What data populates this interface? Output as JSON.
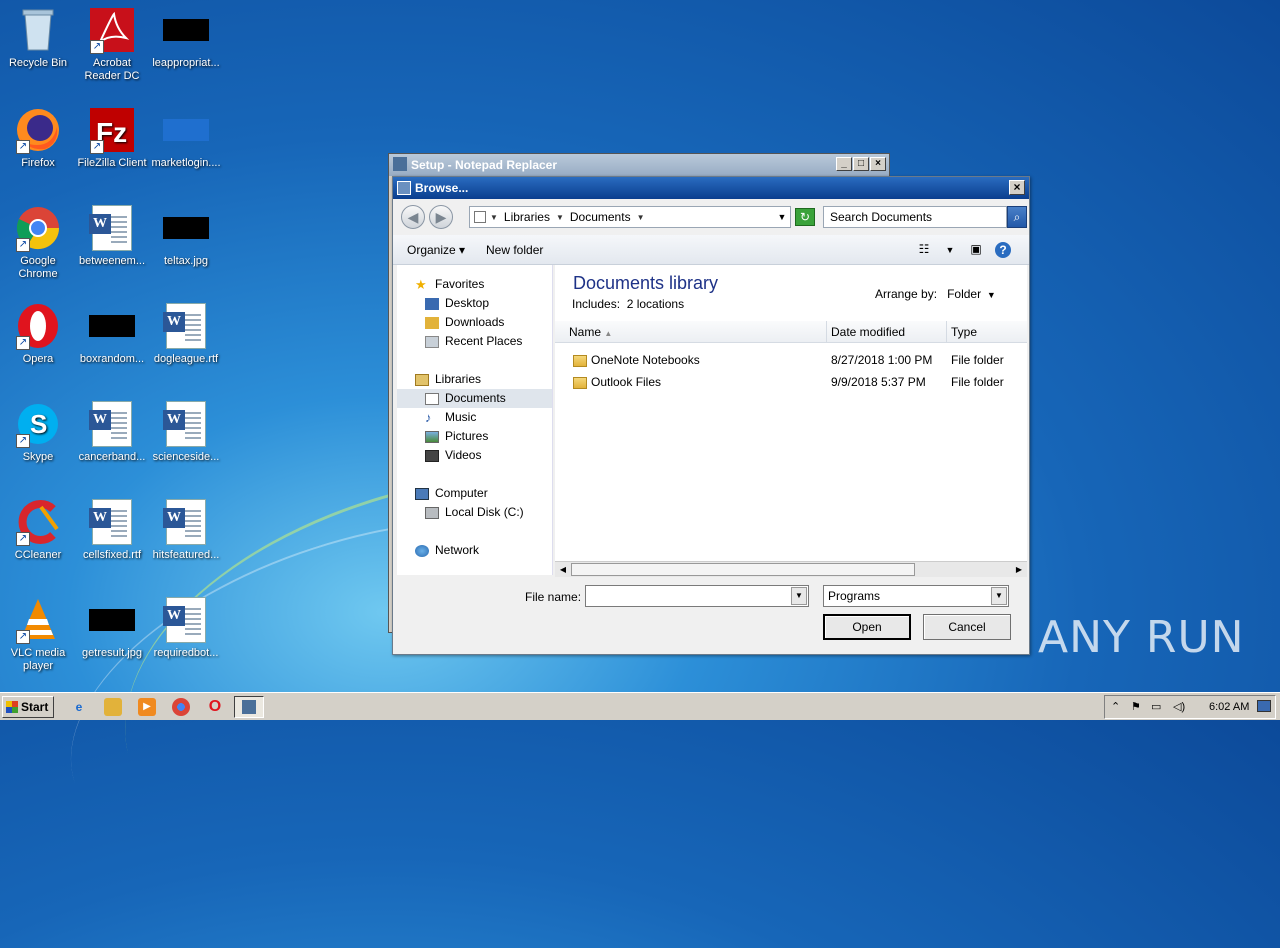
{
  "desktop": {
    "icons": [
      {
        "label": "Recycle Bin"
      },
      {
        "label": "Acrobat Reader DC"
      },
      {
        "label": "leappropriat..."
      },
      {
        "label": "Firefox"
      },
      {
        "label": "FileZilla Client"
      },
      {
        "label": "marketlogin...."
      },
      {
        "label": "Google Chrome"
      },
      {
        "label": "betweenem..."
      },
      {
        "label": "teltax.jpg"
      },
      {
        "label": "Opera"
      },
      {
        "label": "boxrandom..."
      },
      {
        "label": "dogleague.rtf"
      },
      {
        "label": "Skype"
      },
      {
        "label": "cancerband..."
      },
      {
        "label": "scienceside..."
      },
      {
        "label": "CCleaner"
      },
      {
        "label": "cellsfixed.rtf"
      },
      {
        "label": "hitsfeatured..."
      },
      {
        "label": "VLC media player"
      },
      {
        "label": "getresult.jpg"
      },
      {
        "label": "requiredbot..."
      }
    ]
  },
  "setup_window": {
    "title": "Setup - Notepad Replacer"
  },
  "browse_dialog": {
    "title": "Browse...",
    "address": {
      "segments": [
        "Libraries",
        "Documents"
      ]
    },
    "search": {
      "placeholder": "Search Documents"
    },
    "toolbar": {
      "organize": "Organize",
      "new_folder": "New folder"
    },
    "nav": {
      "favorites": "Favorites",
      "desktop": "Desktop",
      "downloads": "Downloads",
      "recent_places": "Recent Places",
      "libraries": "Libraries",
      "documents": "Documents",
      "music": "Music",
      "pictures": "Pictures",
      "videos": "Videos",
      "computer": "Computer",
      "local_disk": "Local Disk (C:)",
      "network": "Network"
    },
    "content": {
      "title": "Documents library",
      "includes_label": "Includes:",
      "includes_value": "2 locations",
      "arrange_label": "Arrange by:",
      "arrange_value": "Folder",
      "columns": {
        "name": "Name",
        "date": "Date modified",
        "type": "Type"
      },
      "rows": [
        {
          "name": "OneNote Notebooks",
          "date": "8/27/2018 1:00 PM",
          "type": "File folder"
        },
        {
          "name": "Outlook Files",
          "date": "9/9/2018 5:37 PM",
          "type": "File folder"
        }
      ]
    },
    "file_name_label": "File name:",
    "file_name_value": "",
    "file_type_value": "Programs",
    "open_label": "Open",
    "cancel_label": "Cancel"
  },
  "taskbar": {
    "start_label": "Start",
    "clock": "6:02 AM"
  },
  "watermark": "ANY RUN"
}
